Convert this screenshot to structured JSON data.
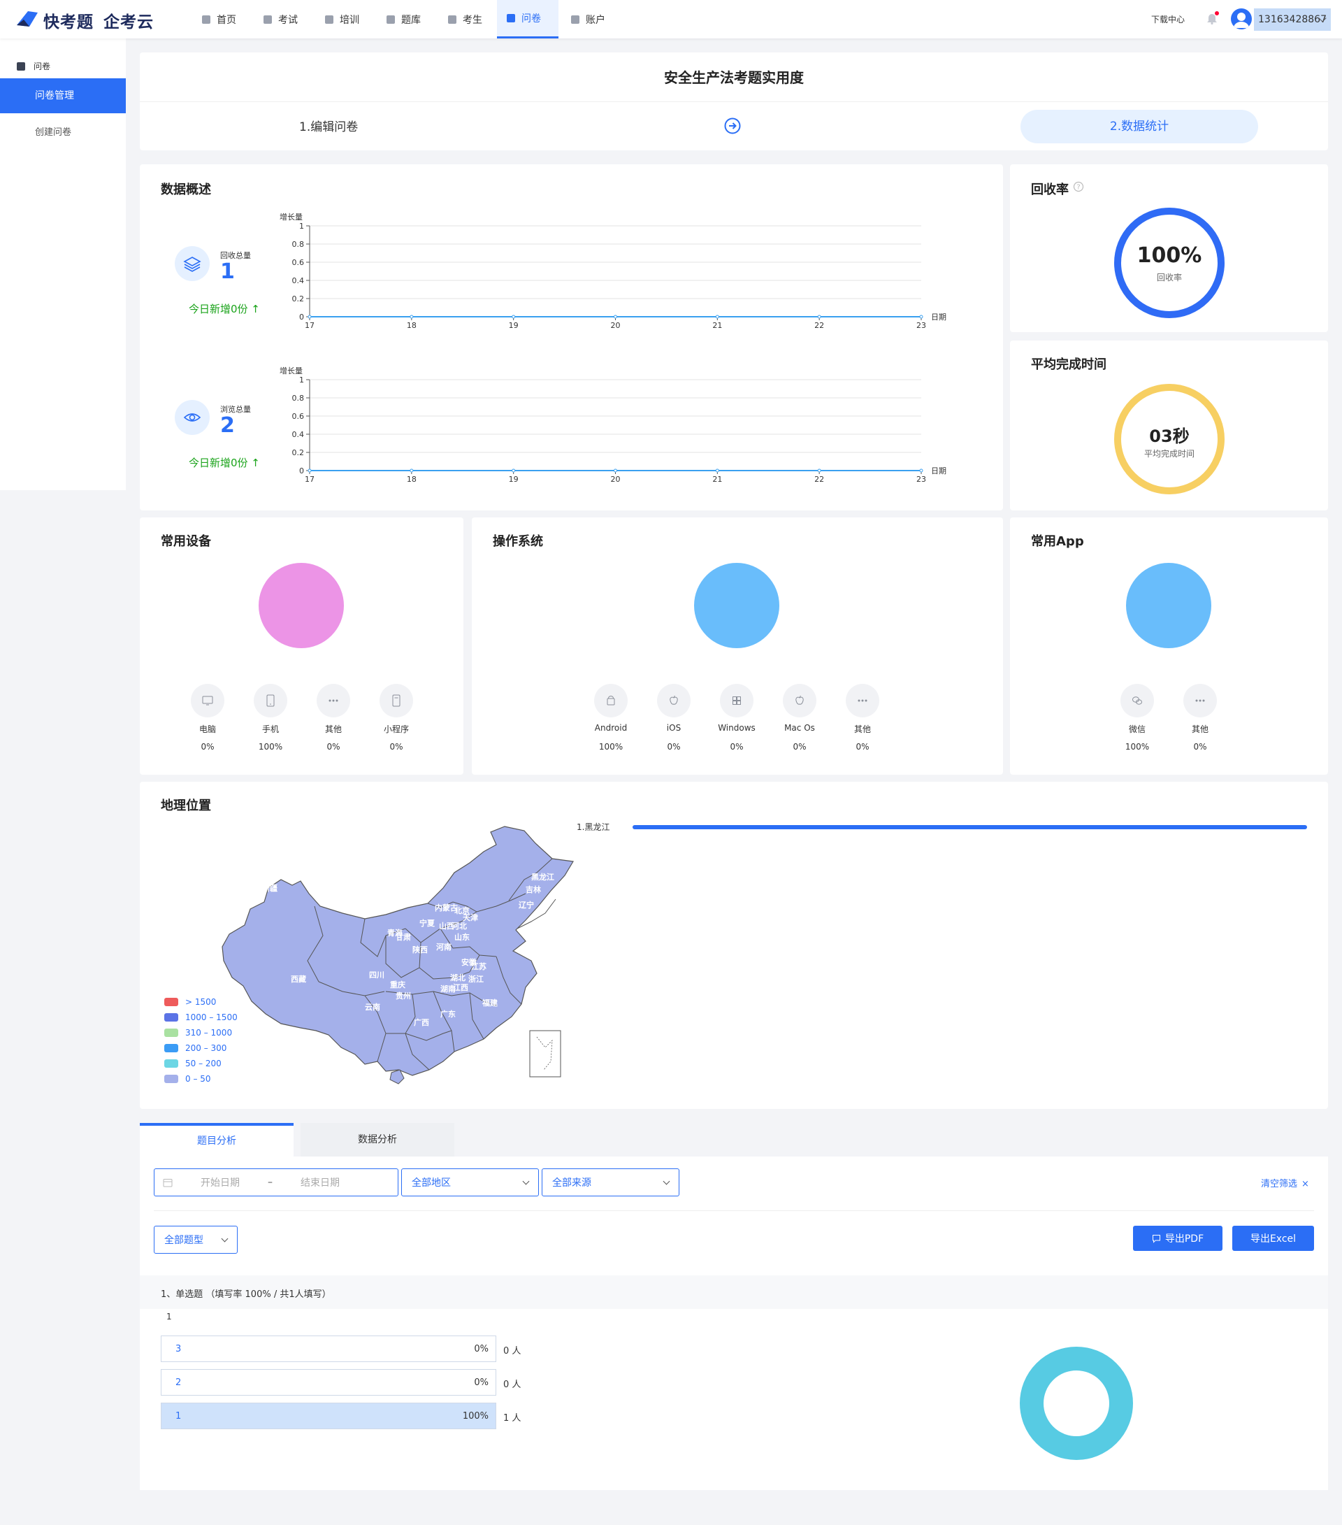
{
  "brand": {
    "name": "快考题",
    "name2": "企考云"
  },
  "nav": {
    "items": [
      {
        "label": "首页",
        "icon": "home-icon"
      },
      {
        "label": "考试",
        "icon": "exam-icon"
      },
      {
        "label": "培训",
        "icon": "training-icon"
      },
      {
        "label": "题库",
        "icon": "question-bank-icon"
      },
      {
        "label": "考生",
        "icon": "examinee-icon"
      },
      {
        "label": "问卷",
        "icon": "survey-icon"
      },
      {
        "label": "账户",
        "icon": "account-icon"
      }
    ],
    "active": "问卷",
    "download": "下载中心",
    "username": "13163428867"
  },
  "sidebar": {
    "section": "问卷",
    "active": "问卷管理",
    "item": "创建问卷"
  },
  "header": {
    "title": "安全生产法考题实用度",
    "step1": "1.编辑问卷",
    "step2": "2.数据统计"
  },
  "overview": {
    "title": "数据概述",
    "recv": {
      "label": "回收总量",
      "value": "1",
      "today": "今日新增0份 ↑"
    },
    "view": {
      "label": "浏览总量",
      "value": "2",
      "today": "今日新增0份 ↑"
    },
    "ylabel": "增长量",
    "xlabel": "日期"
  },
  "chart_data": [
    {
      "type": "line",
      "ylabel": "增长量",
      "xlabel": "日期",
      "x": [
        "17",
        "18",
        "19",
        "20",
        "21",
        "22",
        "23"
      ],
      "y_ticks": [
        "0",
        "0.2",
        "0.4",
        "0.6",
        "0.8",
        "1"
      ],
      "ylim": [
        0,
        1
      ],
      "series": [
        {
          "values": [
            0,
            0,
            0,
            0,
            0,
            0,
            0
          ]
        }
      ]
    },
    {
      "type": "line",
      "ylabel": "增长量",
      "xlabel": "日期",
      "x": [
        "17",
        "18",
        "19",
        "20",
        "21",
        "22",
        "23"
      ],
      "y_ticks": [
        "0",
        "0.2",
        "0.4",
        "0.6",
        "0.8",
        "1"
      ],
      "ylim": [
        0,
        1
      ],
      "series": [
        {
          "values": [
            0,
            0,
            0,
            0,
            0,
            0,
            0
          ]
        }
      ]
    }
  ],
  "rate": {
    "title": "回收率",
    "value": "100%",
    "label": "回收率",
    "fraction": 1.0,
    "color": "#2f6bf5"
  },
  "avg": {
    "title": "平均完成时间",
    "value": "03秒",
    "label": "平均完成时间",
    "color": "#f7cf62"
  },
  "devices": {
    "title": "常用设备",
    "color": "#ec94e6",
    "items": [
      {
        "name": "电脑",
        "pct": "0%",
        "icon": "monitor-icon"
      },
      {
        "name": "手机",
        "pct": "100%",
        "icon": "phone-icon"
      },
      {
        "name": "其他",
        "pct": "0%",
        "icon": "more-icon"
      },
      {
        "name": "小程序",
        "pct": "0%",
        "icon": "mini-program-icon"
      }
    ]
  },
  "os": {
    "title": "操作系统",
    "color": "#69bdfb",
    "items": [
      {
        "name": "Android",
        "pct": "100%",
        "icon": "android-icon"
      },
      {
        "name": "iOS",
        "pct": "0%",
        "icon": "apple-icon"
      },
      {
        "name": "Windows",
        "pct": "0%",
        "icon": "windows-icon"
      },
      {
        "name": "Mac Os",
        "pct": "0%",
        "icon": "mac-icon"
      },
      {
        "name": "其他",
        "pct": "0%",
        "icon": "more-icon"
      }
    ]
  },
  "apps": {
    "title": "常用App",
    "color": "#69bdfb",
    "items": [
      {
        "name": "微信",
        "pct": "100%",
        "icon": "wechat-icon"
      },
      {
        "name": "其他",
        "pct": "0%",
        "icon": "more-icon"
      }
    ]
  },
  "geo": {
    "title": "地理位置",
    "rank_label": "1.黑龙江",
    "rank_fraction": 1.0,
    "legend": [
      {
        "label": "> 1500",
        "color": "#ee5b5b"
      },
      {
        "label": "1000 – 1500",
        "color": "#5b73e6"
      },
      {
        "label": "310 – 1000",
        "color": "#a9e1a1"
      },
      {
        "label": "200 – 300",
        "color": "#3b9cf5"
      },
      {
        "label": "50 – 200",
        "color": "#6cd6e4"
      },
      {
        "label": "0 – 50",
        "color": "#a4b0ea"
      }
    ],
    "provinces": [
      "黑龙江",
      "吉林",
      "辽宁",
      "新疆",
      "内蒙古",
      "北京",
      "天津",
      "宁夏",
      "山西",
      "河北",
      "山东",
      "青海",
      "甘肃",
      "陕西",
      "河南",
      "安徽",
      "江苏",
      "西藏",
      "四川",
      "湖北",
      "浙江",
      "重庆",
      "湖南",
      "江西",
      "云南",
      "贵州",
      "福建",
      "广西",
      "广东"
    ]
  },
  "analysis": {
    "tab_active": "题目分析",
    "tab_other": "数据分析",
    "start_ph": "开始日期",
    "dash": "–",
    "end_ph": "结束日期",
    "region": "全部地区",
    "source": "全部来源",
    "clear": "清空筛选",
    "qtype": "全部题型",
    "export_pdf": "导出PDF",
    "export_excel": "导出Excel",
    "question": "1、单选题 （填写率 100% / 共1人填写）",
    "qstem": "1",
    "options": [
      {
        "label": "3",
        "pct": "0%",
        "count": "0 人",
        "fraction": 0
      },
      {
        "label": "2",
        "pct": "0%",
        "count": "0 人",
        "fraction": 0
      },
      {
        "label": "1",
        "pct": "100%",
        "count": "1 人",
        "fraction": 1
      }
    ],
    "donut_color": "#57cbe3"
  }
}
